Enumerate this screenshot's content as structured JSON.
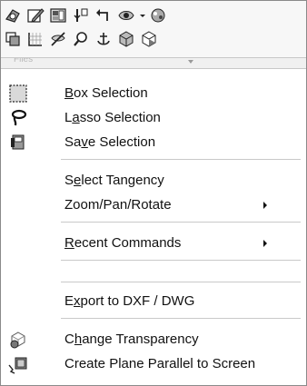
{
  "toolbar": {
    "row1": [
      {
        "icon": "view-orientation-icon",
        "caret": false
      },
      {
        "icon": "sketch-edit-icon",
        "caret": false
      },
      {
        "icon": "display-style-icon",
        "caret": false
      },
      {
        "icon": "section-view-icon",
        "caret": false
      },
      {
        "icon": "previous-view-icon",
        "caret": false
      },
      {
        "icon": "hide-show-items-icon",
        "caret": true
      },
      {
        "icon": "appearance-icon",
        "caret": false
      }
    ],
    "row2": [
      {
        "icon": "view-selector-icon"
      },
      {
        "icon": "grid-view-icon"
      },
      {
        "icon": "hide-lines-icon"
      },
      {
        "icon": "zoom-icon"
      },
      {
        "icon": "anchor-icon"
      },
      {
        "icon": "cube-view-icon"
      },
      {
        "icon": "rotate-view-icon"
      }
    ]
  },
  "strip": {
    "ghost_text": "Files"
  },
  "menu": {
    "box_selection": {
      "pre": "",
      "u": "B",
      "post": "ox Selection"
    },
    "lasso_selection": {
      "pre": "L",
      "u": "a",
      "post": "sso Selection"
    },
    "save_selection": {
      "pre": "Sa",
      "u": "v",
      "post": "e Selection"
    },
    "select_tangency": {
      "pre": "S",
      "u": "e",
      "post": "lect Tangency"
    },
    "zoom_pan_rotate": {
      "label": "Zoom/Pan/Rotate"
    },
    "recent_commands": {
      "pre": "",
      "u": "R",
      "post": "ecent Commands"
    },
    "export_dxf": {
      "pre": "E",
      "u": "x",
      "post": "port to DXF / DWG"
    },
    "change_transparency": {
      "pre": "C",
      "u": "h",
      "post": "ange Transparency"
    },
    "create_plane": {
      "label": "Create Plane Parallel to Screen"
    }
  },
  "colors": {
    "border": "#8a8a8a",
    "separator": "#c9c9c9",
    "text": "#111111"
  }
}
